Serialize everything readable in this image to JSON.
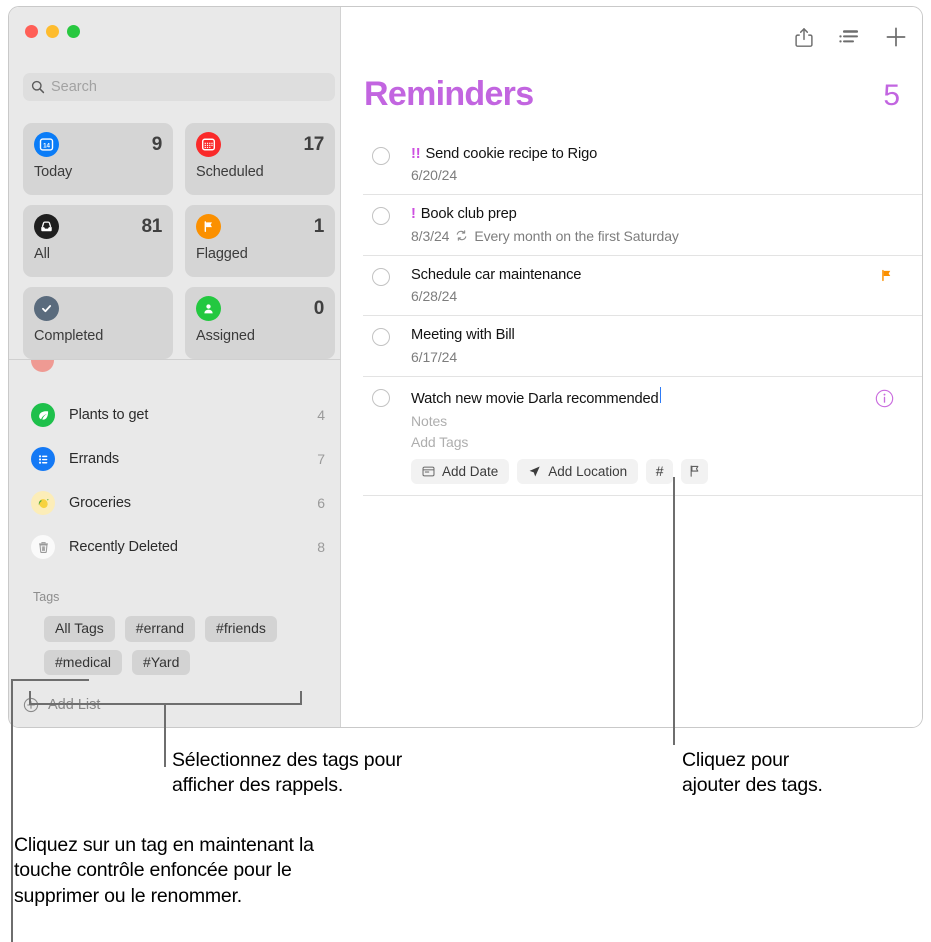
{
  "window": {
    "traffic_lights": [
      "close",
      "minimize",
      "zoom"
    ]
  },
  "sidebar": {
    "search": {
      "placeholder": "Search",
      "icon": "search-icon"
    },
    "smart_cards": [
      {
        "label": "Today",
        "count": "9",
        "icon": "calendar-day-icon",
        "color": "#0a7cf7"
      },
      {
        "label": "Scheduled",
        "count": "17",
        "icon": "calendar-icon",
        "color": "#fa2a2a"
      },
      {
        "label": "All",
        "count": "81",
        "icon": "inbox-tray-icon",
        "color": "#1f1f1f"
      },
      {
        "label": "Flagged",
        "count": "1",
        "icon": "flag-icon",
        "color": "#fb9000"
      },
      {
        "label": "Completed",
        "count": "",
        "icon": "check-circle-icon",
        "color": "#5a6b7d"
      },
      {
        "label": "Assigned",
        "count": "0",
        "icon": "person-icon",
        "color": "#23c840"
      }
    ],
    "lists": [
      {
        "name": "Plants to get",
        "count": "4",
        "icon": "leaf-icon",
        "color": "#1ec04b"
      },
      {
        "name": "Errands",
        "count": "7",
        "icon": "bullet-list-icon",
        "color": "#1479f5"
      },
      {
        "name": "Groceries",
        "count": "6",
        "icon": "lemon-icon",
        "color": "#fcedb8"
      },
      {
        "name": "Recently Deleted",
        "count": "8",
        "icon": "trash-icon",
        "color": "#fafafa"
      }
    ],
    "tags_header": "Tags",
    "tags": [
      "All Tags",
      "#errand",
      "#friends",
      "#medical",
      "#Yard"
    ],
    "add_list": {
      "label": "Add List",
      "icon": "plus-circle-icon"
    }
  },
  "main": {
    "toolbar": [
      {
        "name": "share-icon",
        "label": "Share"
      },
      {
        "name": "sort-list-icon",
        "label": "List options"
      },
      {
        "name": "plus-icon",
        "label": "New reminder"
      }
    ],
    "title": "Reminders",
    "count": "5",
    "accent_color": "#c265e0",
    "reminders": [
      {
        "priority": "!!",
        "title": "Send cookie recipe to Rigo",
        "date": "6/20/24",
        "repeat": "",
        "flagged": false,
        "editing": false
      },
      {
        "priority": "!",
        "title": "Book club prep",
        "date": "8/3/24",
        "repeat": "Every month on the first Saturday",
        "flagged": false,
        "editing": false
      },
      {
        "priority": "",
        "title": "Schedule car maintenance",
        "date": "6/28/24",
        "repeat": "",
        "flagged": true,
        "editing": false
      },
      {
        "priority": "",
        "title": "Meeting with Bill",
        "date": "6/17/24",
        "repeat": "",
        "flagged": false,
        "editing": false
      },
      {
        "priority": "",
        "title": "Watch new movie Darla recommended",
        "date": "",
        "repeat": "",
        "flagged": false,
        "editing": true,
        "notes_placeholder": "Notes",
        "tags_placeholder": "Add Tags",
        "detail_buttons": [
          {
            "label": "Add Date",
            "icon": "calendar-small-icon"
          },
          {
            "label": "Add Location",
            "icon": "location-arrow-icon"
          },
          {
            "label": "#",
            "icon": "hashtag-icon"
          },
          {
            "label": "",
            "icon": "flag-outline-icon"
          }
        ],
        "info_icon": "info-circle-icon"
      }
    ]
  },
  "callouts": [
    {
      "id": "select-tags",
      "text": "Sélectionnez des tags pour\nafficher des rappels."
    },
    {
      "id": "add-tags",
      "text": "Cliquez pour\najouter des tags."
    },
    {
      "id": "control-click",
      "text": "Cliquez sur un tag en maintenant la\ntouche contrôle enfoncée pour le\nsupprimer ou le renommer."
    }
  ]
}
